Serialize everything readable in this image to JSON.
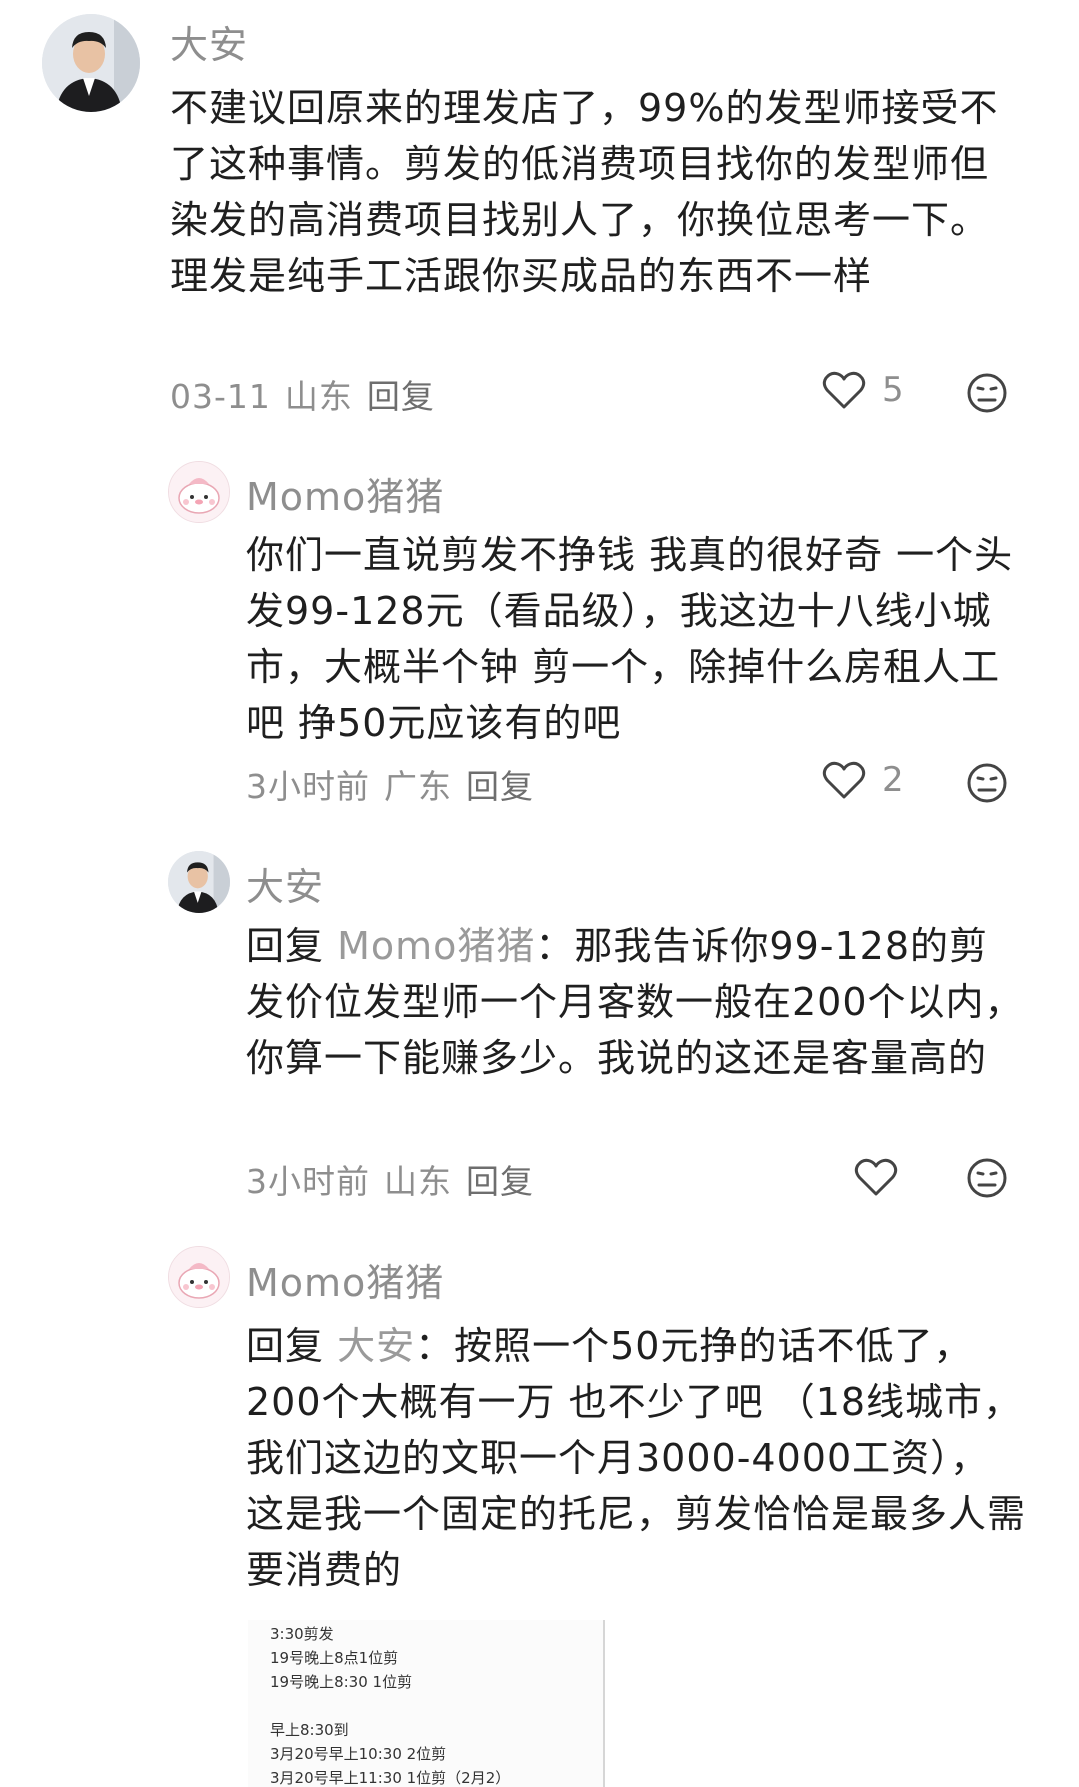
{
  "comments": [
    {
      "author": "大安",
      "text": "不建议回原来的理发店了，99%的发型师接受不了这种事情。剪发的低消费项目找你的发型师但染发的高消费项目找别人了，你换位思考一下。理发是纯手工活跟你买成品的东西不一样",
      "date": "03-11",
      "location": "山东",
      "reply_label": "回复",
      "likes": "5"
    },
    {
      "author": "Momo猪猪",
      "text": "你们一直说剪发不挣钱 我真的很好奇 一个头发99-128元（看品级），我这边十八线小城市，大概半个钟 剪一个，除掉什么房租人工吧 挣50元应该有的吧",
      "date": "3小时前",
      "location": "广东",
      "reply_label": "回复",
      "likes": "2"
    },
    {
      "author": "大安",
      "reply_prefix": "回复",
      "reply_to": "Momo猪猪",
      "text": "：那我告诉你99-128的剪发价位发型师一个月客数一般在200个以内，你算一下能赚多少。我说的这还是客量高的",
      "date": "3小时前",
      "location": "山东",
      "reply_label": "回复",
      "likes": ""
    },
    {
      "author": "Momo猪猪",
      "reply_prefix": "回复",
      "reply_to": "大安",
      "text": "：按照一个50元挣的话不低了，200个大概有一万 也不少了吧 （18线城市，我们这边的文职一个月3000-4000工资）， 这是我一个固定的托尼，剪发恰恰是最多人需要消费的"
    }
  ],
  "attachment": {
    "lines": [
      "3:30剪发",
      "19号晚上8点1位剪",
      "19号晚上8:30 1位剪",
      "",
      "早上8:30到",
      "3月20号早上10:30 2位剪",
      "3月20号早上11:30 1位剪（2月2）"
    ]
  },
  "icons": {
    "like": "heart-outline-icon",
    "dislike": "dislike-face-icon"
  },
  "colors": {
    "text": "#1f1f1f",
    "muted": "#8e8e8e",
    "icon": "#444444"
  }
}
